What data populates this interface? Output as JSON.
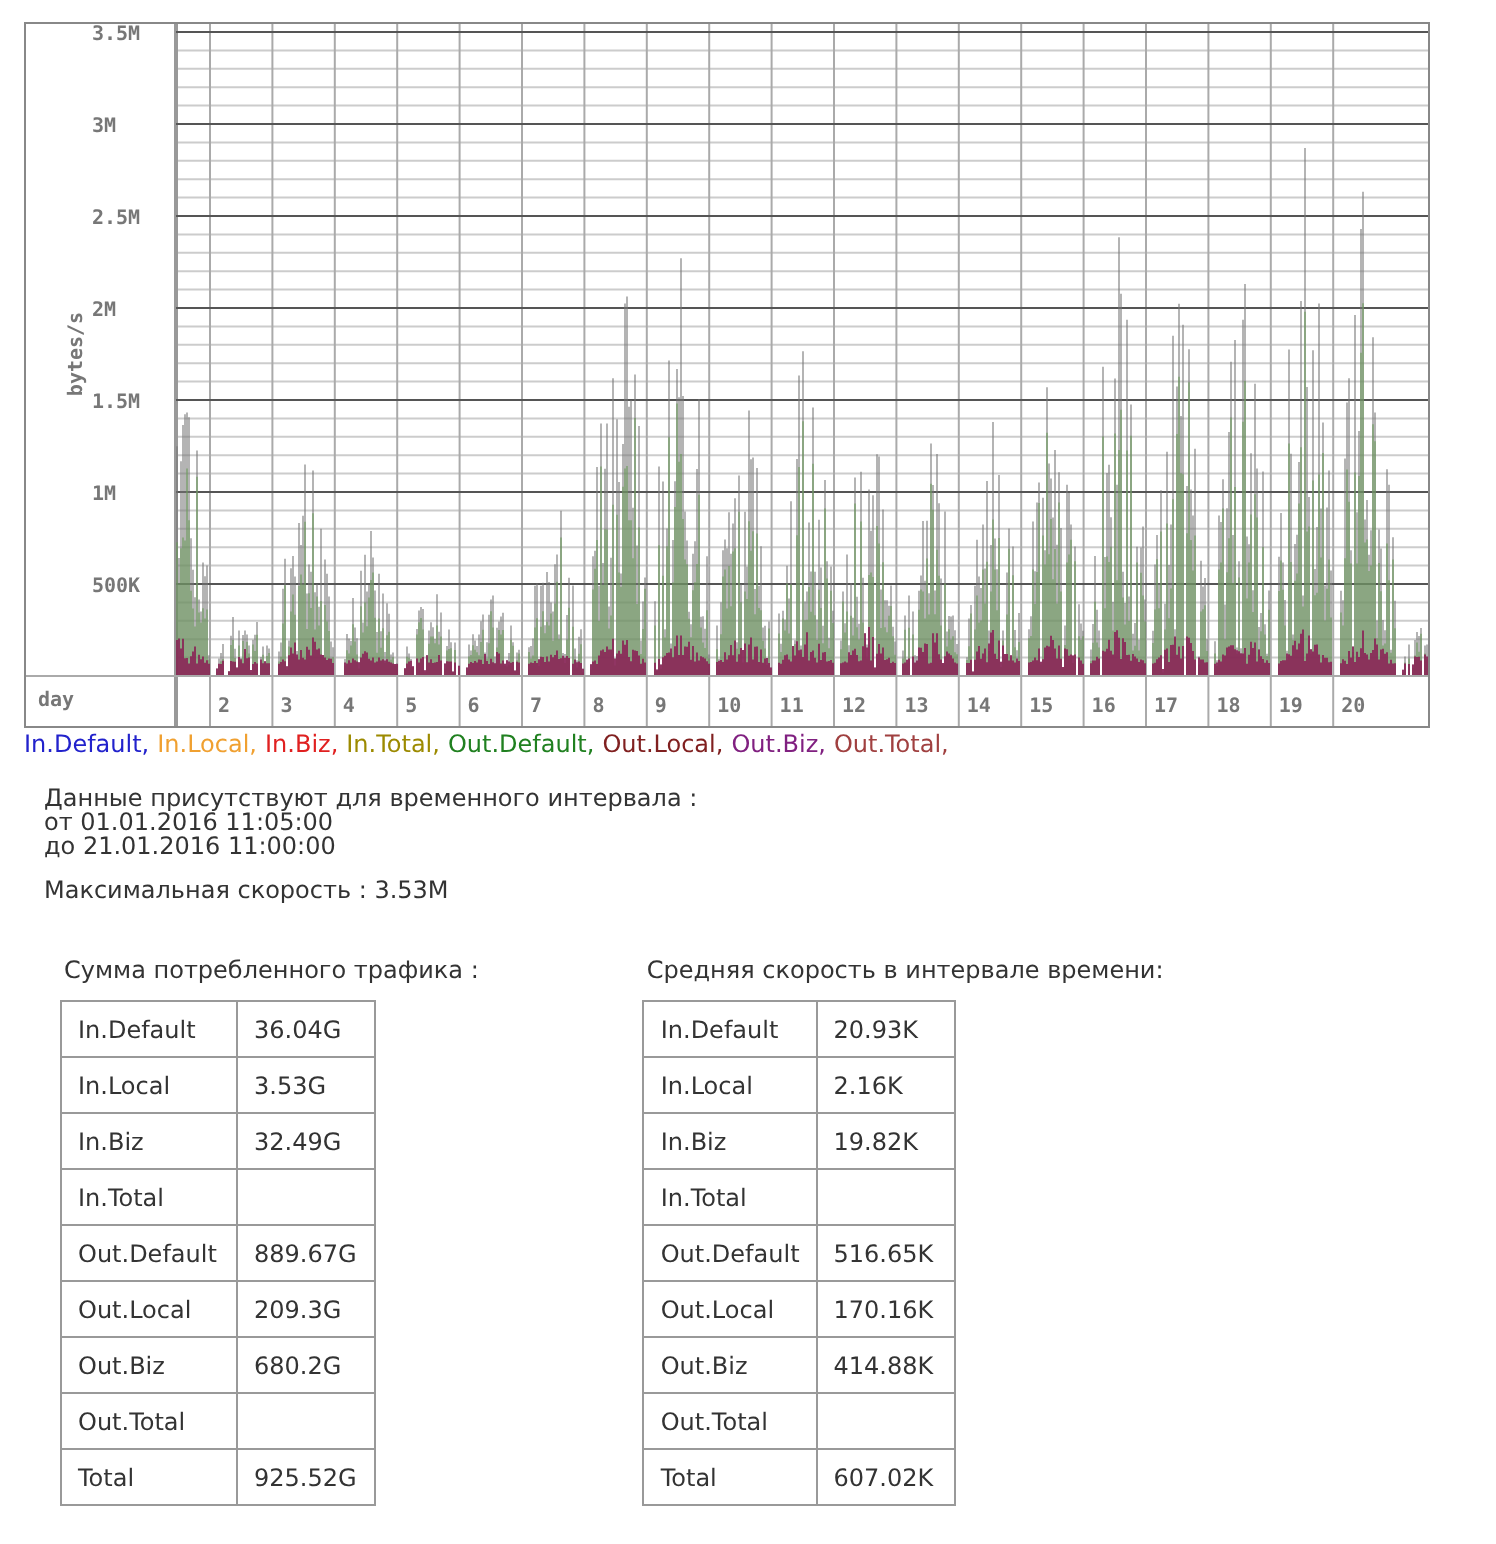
{
  "chart": {
    "y_axis_label": "bytes/s",
    "y_ticks": [
      "3.5M",
      "3M",
      "2.5M",
      "2M",
      "1.5M",
      "1M",
      "500K"
    ],
    "x_axis_label": "day",
    "x_ticks": [
      "2",
      "3",
      "4",
      "5",
      "6",
      "7",
      "8",
      "9",
      "10",
      "11",
      "12",
      "13",
      "14",
      "15",
      "16",
      "17",
      "18",
      "19",
      "20"
    ]
  },
  "legend": [
    {
      "label": "In.Default,",
      "color": "#2222cc"
    },
    {
      "label": "In.Local,",
      "color": "#f0a030"
    },
    {
      "label": "In.Biz,",
      "color": "#e02020"
    },
    {
      "label": "In.Total,",
      "color": "#9c8a00"
    },
    {
      "label": "Out.Default,",
      "color": "#208020"
    },
    {
      "label": "Out.Local,",
      "color": "#802020"
    },
    {
      "label": "Out.Biz,",
      "color": "#802080"
    },
    {
      "label": "Out.Total,",
      "color": "#a04040"
    }
  ],
  "interval": {
    "lines": [
      "Данные присутствуют для временного интервала :",
      "от 01.01.2016 11:05:00",
      "до 21.01.2016 11:00:00"
    ]
  },
  "max_speed": "Максимальная скорость : 3.53M",
  "tables": [
    {
      "title": "Сумма потребленного трафика :",
      "rows": [
        {
          "label": "In.Default",
          "value": "36.04G"
        },
        {
          "label": "In.Local",
          "value": "3.53G"
        },
        {
          "label": "In.Biz",
          "value": "32.49G"
        },
        {
          "label": "In.Total"
        },
        {
          "label": "Out.Default",
          "value": "889.67G"
        },
        {
          "label": "Out.Local",
          "value": "209.3G"
        },
        {
          "label": "Out.Biz",
          "value": "680.2G"
        },
        {
          "label": "Out.Total"
        },
        {
          "label": "Total",
          "value": "925.52G"
        }
      ]
    },
    {
      "title": "Средняя скорость в интервале времени:",
      "rows": [
        {
          "label": "In.Default",
          "value": "20.93K"
        },
        {
          "label": "In.Local",
          "value": "2.16K"
        },
        {
          "label": "In.Biz",
          "value": "19.82K"
        },
        {
          "label": "In.Total"
        },
        {
          "label": "Out.Default",
          "value": "516.65K"
        },
        {
          "label": "Out.Local",
          "value": "170.16K"
        },
        {
          "label": "Out.Biz",
          "value": "414.88K"
        },
        {
          "label": "Out.Total"
        },
        {
          "label": "Total",
          "value": "607.02K"
        }
      ]
    }
  ]
}
